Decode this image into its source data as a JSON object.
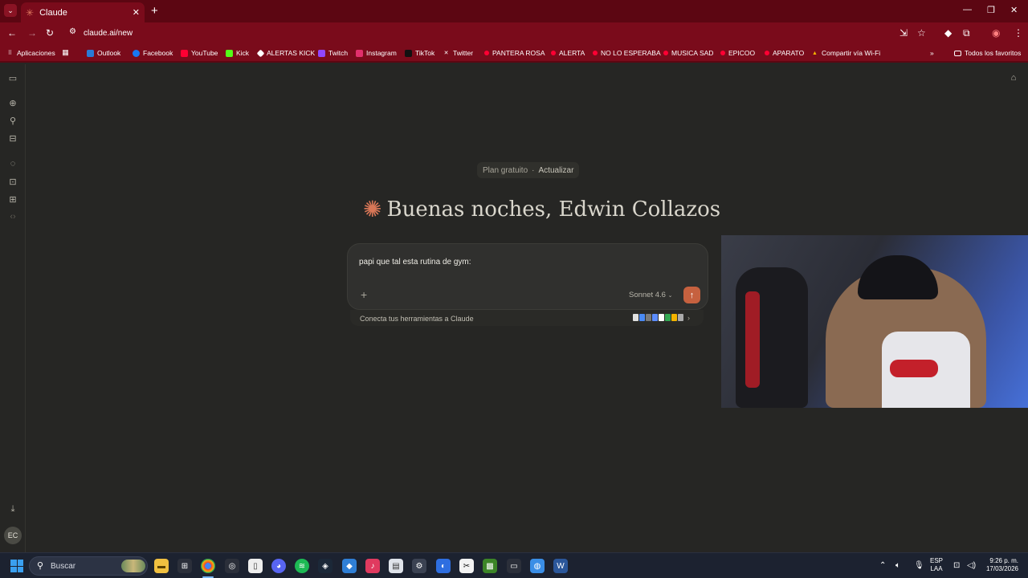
{
  "browser": {
    "tab_title": "Claude",
    "url": "claude.ai/new",
    "bookmarks": [
      {
        "label": "Aplicaciones",
        "icon": "apps-grid-icon"
      },
      {
        "label": "Outlook",
        "icon": "outlook-icon"
      },
      {
        "label": "Facebook",
        "icon": "facebook-icon"
      },
      {
        "label": "YouTube",
        "icon": "youtube-icon"
      },
      {
        "label": "Kick",
        "icon": "kick-icon"
      },
      {
        "label": "ALERTAS KICK",
        "icon": "kick-alert-icon"
      },
      {
        "label": "Twitch",
        "icon": "twitch-icon"
      },
      {
        "label": "Instagram",
        "icon": "instagram-icon"
      },
      {
        "label": "TikTok",
        "icon": "tiktok-icon"
      },
      {
        "label": "Twitter",
        "icon": "x-icon"
      },
      {
        "label": "PANTERA ROSA",
        "icon": "youtube-icon"
      },
      {
        "label": "ALERTA",
        "icon": "youtube-icon"
      },
      {
        "label": "NO LO ESPERABA",
        "icon": "youtube-icon"
      },
      {
        "label": "MUSICA SAD",
        "icon": "youtube-icon"
      },
      {
        "label": "EPICOO",
        "icon": "youtube-icon"
      },
      {
        "label": "APARATO",
        "icon": "youtube-icon"
      },
      {
        "label": "Compartir vía Wi-Fi",
        "icon": "warning-icon"
      }
    ],
    "all_bookmarks": "Todos los favoritos"
  },
  "sidebar": {
    "avatar_initials": "EC"
  },
  "main": {
    "plan_label": "Plan gratuito",
    "plan_separator": "·",
    "upgrade_label": "Actualizar",
    "greeting": "Buenas noches, Edwin Collazos",
    "composer_text": "papi que tal esta rutina de gym:",
    "model_label": "Sonnet 4.6",
    "connect_label": "Conecta tus herramientas a Claude"
  },
  "taskbar": {
    "search_placeholder": "Buscar",
    "lang_line1": "ESP",
    "lang_line2": "LAA",
    "time": "9:26 p. m.",
    "date": "17/03/2026"
  },
  "colors": {
    "chrome_theme": "#7a0b1b",
    "accent": "#d97757",
    "send_button": "#c6613f",
    "background": "#262624"
  }
}
